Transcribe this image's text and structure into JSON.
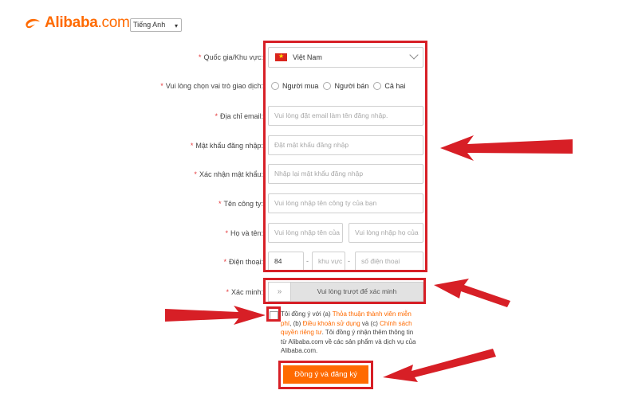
{
  "header": {
    "logo_name": "Alibaba",
    "logo_domain": ".com",
    "language_selected": "Tiếng Anh"
  },
  "form": {
    "country": {
      "label": "Quốc gia/Khu vực:",
      "value": "Việt Nam",
      "flag_icon": "vietnam-flag-icon"
    },
    "role": {
      "label": "Vui lòng chọn vai trò giao dịch:",
      "options": [
        "Người mua",
        "Người bán",
        "Cả hai"
      ]
    },
    "email": {
      "label": "Địa chỉ email:",
      "placeholder": "Vui lòng đặt email làm tên đăng nhập."
    },
    "password": {
      "label": "Mật khẩu đăng nhập:",
      "placeholder": "Đặt mật khẩu đăng nhập"
    },
    "confirm_password": {
      "label": "Xác nhận mật khẩu:",
      "placeholder": "Nhập lại mật khẩu đăng nhập"
    },
    "company": {
      "label": "Tên công ty:",
      "placeholder": "Vui lòng nhập tên công ty của bạn"
    },
    "full_name": {
      "label": "Họ và tên:",
      "first_placeholder": "Vui lòng nhập tên của",
      "last_placeholder": "Vui lòng nhập họ của"
    },
    "phone": {
      "label": "Điện thoại:",
      "country_code": "84",
      "separator": "-",
      "area_placeholder": "khu vực",
      "number_placeholder": "số điện thoại"
    },
    "verify": {
      "label": "Xác minh:",
      "handle": "»",
      "hint": "Vui lòng trượt để xác minh"
    },
    "terms": {
      "t1": "Tôi đồng ý với (a) ",
      "link1": "Thỏa thuận thành viên miễn phí",
      "t2": ", (b) ",
      "link2": "Điều khoản sử dụng",
      "t3": " và (c) ",
      "link3": "Chính sách quyền riêng tư",
      "t4": ". Tôi đồng ý nhận thêm thông tin từ Alibaba.com về các sản phẩm và dịch vụ của Alibaba.com."
    },
    "submit_label": "Đồng ý và đăng ký",
    "required_mark": "*"
  },
  "colors": {
    "accent": "#ff6a00",
    "annotation": "#d71f26",
    "required": "#e4393c"
  }
}
